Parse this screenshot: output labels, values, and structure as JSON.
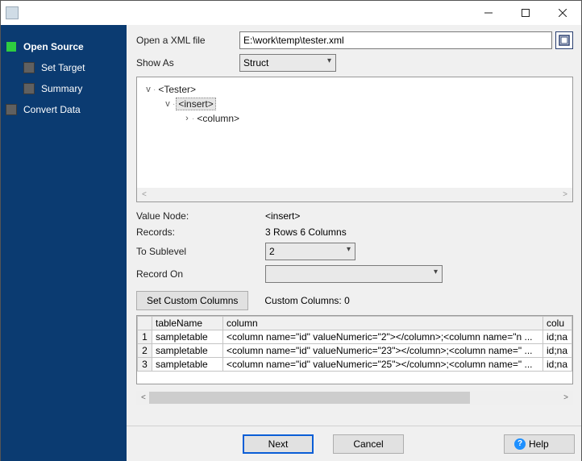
{
  "window": {
    "title": ""
  },
  "sidebar": {
    "items": [
      {
        "label": "Open Source",
        "active": true
      },
      {
        "label": "Set Target"
      },
      {
        "label": "Summary"
      },
      {
        "label": "Convert Data"
      }
    ]
  },
  "form": {
    "open_file_label": "Open a XML file",
    "open_file_value": "E:\\work\\temp\\tester.xml",
    "show_as_label": "Show As",
    "show_as_value": "Struct",
    "value_node_label": "Value Node:",
    "value_node_value": "<insert>",
    "records_label": "Records:",
    "records_value": "3 Rows   6 Columns",
    "to_sublevel_label": "To Sublevel",
    "to_sublevel_value": "2",
    "record_on_label": "Record On",
    "record_on_value": "",
    "set_custom_btn": "Set Custom Columns",
    "custom_cols_label": "Custom Columns: 0"
  },
  "tree": {
    "nodes": [
      {
        "indent": 0,
        "twisty": "v",
        "text": "<Tester>"
      },
      {
        "indent": 1,
        "twisty": "v",
        "text": "<insert>",
        "selected": true
      },
      {
        "indent": 2,
        "twisty": ">",
        "text": "<column>"
      }
    ]
  },
  "grid": {
    "headers": [
      "",
      "tableName",
      "column",
      "colu"
    ],
    "rows": [
      {
        "n": "1",
        "tableName": "sampletable",
        "column": "<column name=\"id\" valueNumeric=\"2\"></column>;<column name=\"n ...",
        "colu": "id;na"
      },
      {
        "n": "2",
        "tableName": "sampletable",
        "column": "<column name=\"id\" valueNumeric=\"23\"></column>;<column name=\" ...",
        "colu": "id;na"
      },
      {
        "n": "3",
        "tableName": "sampletable",
        "column": "<column name=\"id\" valueNumeric=\"25\"></column>;<column name=\" ...",
        "colu": "id;na"
      }
    ]
  },
  "buttons": {
    "next": "Next",
    "cancel": "Cancel",
    "help": "Help"
  }
}
